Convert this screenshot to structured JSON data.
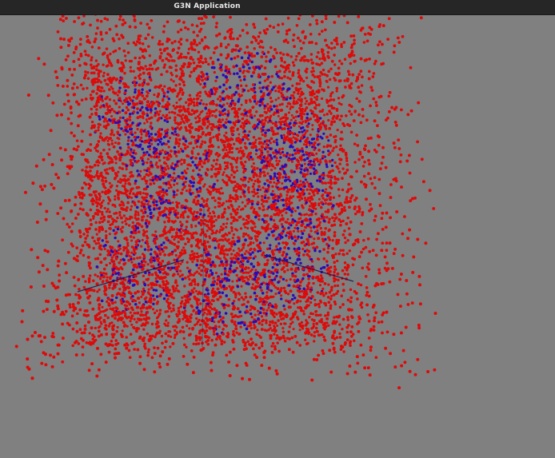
{
  "window": {
    "title": "G3N Application"
  },
  "scene": {
    "background_color": "#808080",
    "point_colors": {
      "red": "#dd0a0a",
      "blue": "#2a0ab8"
    },
    "axis_color": "#1a1050"
  }
}
